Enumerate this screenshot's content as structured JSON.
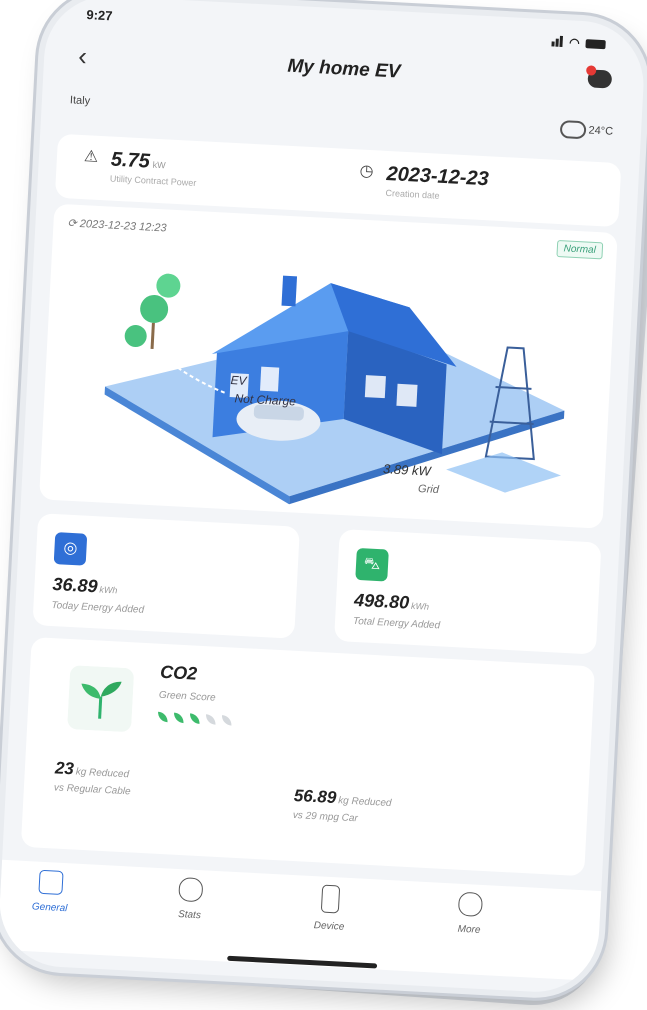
{
  "status": {
    "time": "9:27"
  },
  "header": {
    "title": "My home EV"
  },
  "location": {
    "name": "Italy",
    "temperature": "24°C"
  },
  "stats": {
    "contract_power": {
      "value": "5.75",
      "unit": "kW",
      "label": "Utility Contract Power"
    },
    "creation": {
      "value": "2023-12-23",
      "label": "Creation date"
    }
  },
  "scene": {
    "timestamp": "2023-12-23 12:23",
    "status_badge": "Normal",
    "ev_label": "EV",
    "ev_status": "Not Charge",
    "grid_power": "3.89 kW",
    "grid_label": "Grid"
  },
  "energy": {
    "today": {
      "value": "36.89",
      "unit": "kWh",
      "label": "Today Energy Added",
      "color": "#2f6fd6"
    },
    "total": {
      "value": "498.80",
      "unit": "kWh",
      "label": "Total Energy Added",
      "color": "#2fb36d"
    }
  },
  "co2": {
    "title": "CO2",
    "subtitle": "Green Score",
    "green_score": 3,
    "green_score_max": 5,
    "reduced_cable": {
      "value": "23",
      "unit": "kg Reduced",
      "label": "vs Regular Cable"
    },
    "reduced_car": {
      "value": "56.89",
      "unit": "kg Reduced",
      "label": "vs 29 mpg Car"
    }
  },
  "tabs": [
    {
      "label": "General",
      "icon": "general-icon",
      "active": true
    },
    {
      "label": "Stats",
      "icon": "stats-icon",
      "active": false
    },
    {
      "label": "Device",
      "icon": "device-icon",
      "active": false
    },
    {
      "label": "More",
      "icon": "more-icon",
      "active": false
    }
  ]
}
